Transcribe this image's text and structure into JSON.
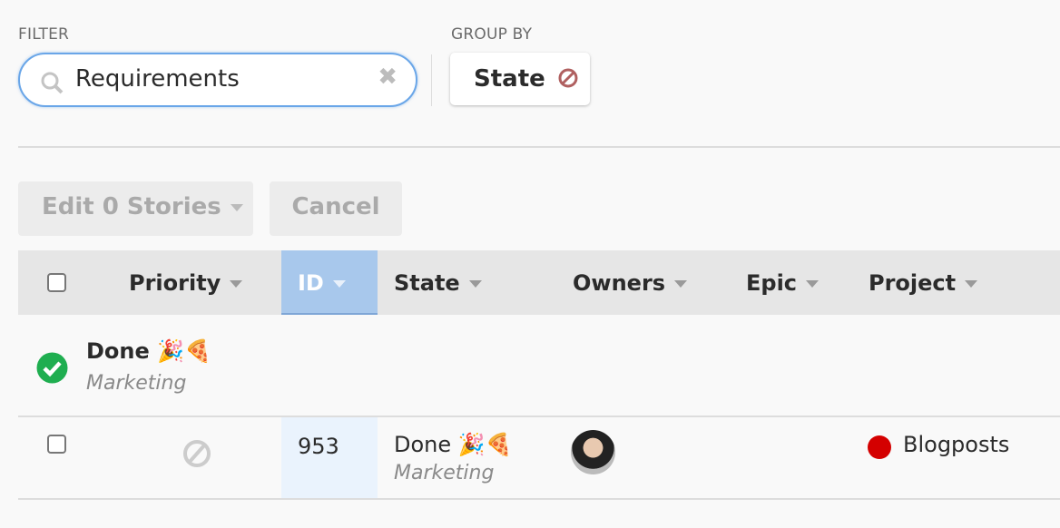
{
  "filter": {
    "label": "FILTER",
    "value": "Requirements"
  },
  "group_by": {
    "label": "GROUP BY",
    "value": "State"
  },
  "actions": {
    "edit": "Edit 0 Stories",
    "cancel": "Cancel"
  },
  "columns": [
    "Priority",
    "ID",
    "State",
    "Owners",
    "Epic",
    "Project"
  ],
  "group": {
    "title": "Done 🎉🍕",
    "subtitle": "Marketing"
  },
  "rows": [
    {
      "id": "953",
      "state": "Done 🎉🍕",
      "state_sub": "Marketing",
      "project": "Blogposts",
      "project_color": "#d40000"
    }
  ]
}
